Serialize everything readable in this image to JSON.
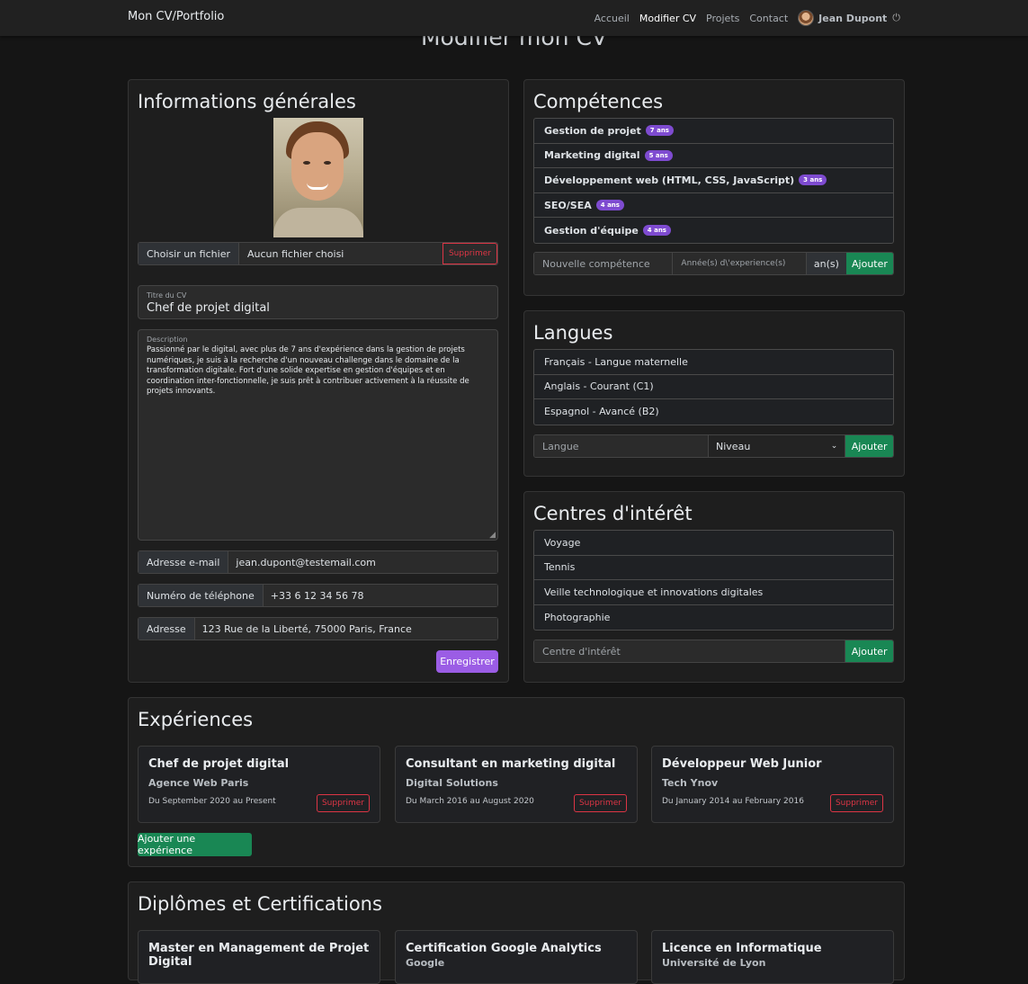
{
  "nav": {
    "brand": "Mon CV/Portfolio",
    "links": [
      "Accueil",
      "Modifier CV",
      "Projets",
      "Contact"
    ],
    "user": "Jean Dupont"
  },
  "page_title": "Modifier mon CV",
  "general": {
    "title": "Informations générales",
    "file_button": "Choisir un fichier",
    "file_name": "Aucun fichier choisi",
    "delete_label": "Supprimer",
    "cv_title_label": "Titre du CV",
    "cv_title_value": "Chef de projet digital",
    "description_label": "Description",
    "description_value": "Passionné par le digital, avec plus de 7 ans d'expérience dans la gestion de projets numériques, je suis à la recherche d'un nouveau challenge dans le domaine de la transformation digitale. Fort d'une solide expertise en gestion d'équipes et en coordination inter-fonctionnelle, je suis prêt à contribuer activement à la réussite de projets innovants.",
    "email_label": "Adresse e-mail",
    "email_value": "jean.dupont@testemail.com",
    "phone_label": "Numéro de téléphone",
    "phone_value": "+33 6 12 34 56 78",
    "address_label": "Adresse",
    "address_value": "123 Rue de la Liberté, 75000 Paris, France",
    "save_label": "Enregistrer"
  },
  "skills": {
    "title": "Compétences",
    "items": [
      {
        "name": "Gestion de projet",
        "years": "7 ans"
      },
      {
        "name": "Marketing digital",
        "years": "5 ans"
      },
      {
        "name": "Développement web (HTML, CSS, JavaScript)",
        "years": "3 ans"
      },
      {
        "name": "SEO/SEA",
        "years": "4 ans"
      },
      {
        "name": "Gestion d'équipe",
        "years": "4 ans"
      }
    ],
    "new_placeholder": "Nouvelle compétence",
    "years_placeholder": "Année(s) d\\'experience(s)",
    "unit": "an(s)",
    "add_label": "Ajouter"
  },
  "languages": {
    "title": "Langues",
    "items": [
      "Français - Langue maternelle",
      "Anglais - Courant (C1)",
      "Espagnol - Avancé (B2)"
    ],
    "lang_placeholder": "Langue",
    "level_selected": "Niveau",
    "add_label": "Ajouter"
  },
  "interests": {
    "title": "Centres d'intérêt",
    "items": [
      "Voyage",
      "Tennis",
      "Veille technologique et innovations digitales",
      "Photographie"
    ],
    "placeholder": "Centre d'intérêt",
    "add_label": "Ajouter"
  },
  "experiences": {
    "title": "Expériences",
    "items": [
      {
        "title": "Chef de projet digital",
        "company": "Agence Web Paris",
        "dates": "Du September 2020 au Present",
        "delete": "Supprimer"
      },
      {
        "title": "Consultant en marketing digital",
        "company": "Digital Solutions",
        "dates": "Du March 2016 au August 2020",
        "delete": "Supprimer"
      },
      {
        "title": "Développeur Web Junior",
        "company": "Tech Ynov",
        "dates": "Du January 2014 au February 2016",
        "delete": "Supprimer"
      }
    ],
    "add_label": "Ajouter une expérience"
  },
  "diplomas": {
    "title": "Diplômes et Certifications",
    "items": [
      {
        "title": "Master en Management de Projet Digital",
        "org": ""
      },
      {
        "title": "Certification Google Analytics",
        "org": "Google"
      },
      {
        "title": "Licence en Informatique",
        "org": "Université de Lyon"
      }
    ]
  }
}
